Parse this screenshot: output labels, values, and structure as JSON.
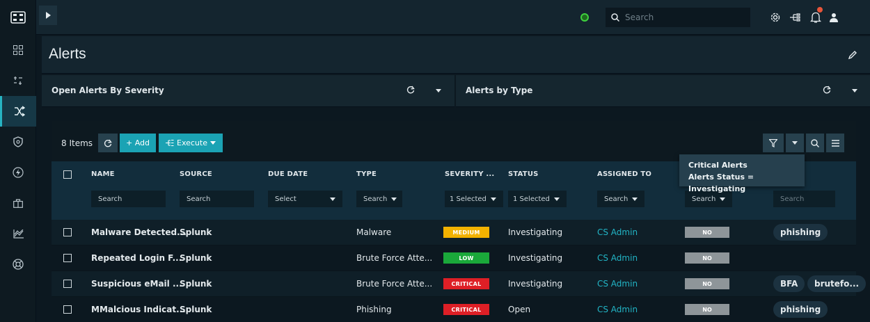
{
  "nav_rail": [
    "dashboard-icon",
    "queue-icon",
    "shuffle-icon",
    "shield-icon",
    "bolt-icon",
    "briefcase-icon",
    "chart-icon",
    "lifebuoy-icon"
  ],
  "topbar": {
    "search_placeholder": "Search"
  },
  "page": {
    "title": "Alerts"
  },
  "widgets": [
    {
      "title": "Open Alerts By Severity"
    },
    {
      "title": "Alerts by Type"
    }
  ],
  "grid": {
    "items_count": "8 Items",
    "add_label": "+ Add",
    "execute_label": "Execute",
    "columns": [
      {
        "header": "NAME",
        "filter": "Search"
      },
      {
        "header": "SOURCE",
        "filter": "Search"
      },
      {
        "header": "DUE DATE",
        "filter": "Select"
      },
      {
        "header": "TYPE",
        "filter": "Search"
      },
      {
        "header": "SEVERITY ...",
        "filter": "1 Selected"
      },
      {
        "header": "STATUS",
        "filter": "1 Selected"
      },
      {
        "header": "ASSIGNED TO",
        "filter": "Search"
      },
      {
        "header": "",
        "filter": "Search"
      },
      {
        "header": "",
        "filter": "Search"
      }
    ],
    "filter_tooltip": {
      "line1": "Critical Alerts",
      "line2": "Alerts Status = Investigating"
    },
    "rows": [
      {
        "name": "Malware Detected...",
        "source": "Splunk",
        "due": "",
        "type": "Malware",
        "severity": "MEDIUM",
        "status": "Investigating",
        "assigned": "CS Admin",
        "flag": "NO",
        "tags": [
          "phishing"
        ]
      },
      {
        "name": "Repeated Login F...",
        "source": "Splunk",
        "due": "",
        "type": "Brute Force Atte...",
        "severity": "LOW",
        "status": "Investigating",
        "assigned": "CS Admin",
        "flag": "NO",
        "tags": []
      },
      {
        "name": "Suspicious eMail ...",
        "source": "Splunk",
        "due": "",
        "type": "Brute Force Atte...",
        "severity": "CRITICAL",
        "status": "Investigating",
        "assigned": "CS Admin",
        "flag": "NO",
        "tags": [
          "BFA",
          "brutefo..."
        ]
      },
      {
        "name": "MMalcious Indicat...",
        "source": "Splunk",
        "due": "",
        "type": "Phishing",
        "severity": "CRITICAL",
        "status": "Open",
        "assigned": "CS Admin",
        "flag": "NO",
        "tags": [
          "phishing"
        ]
      }
    ]
  },
  "colors": {
    "accent": "#1ba3b4",
    "medium": "#f3b200",
    "low": "#1aa83a",
    "critical": "#de1f26"
  }
}
